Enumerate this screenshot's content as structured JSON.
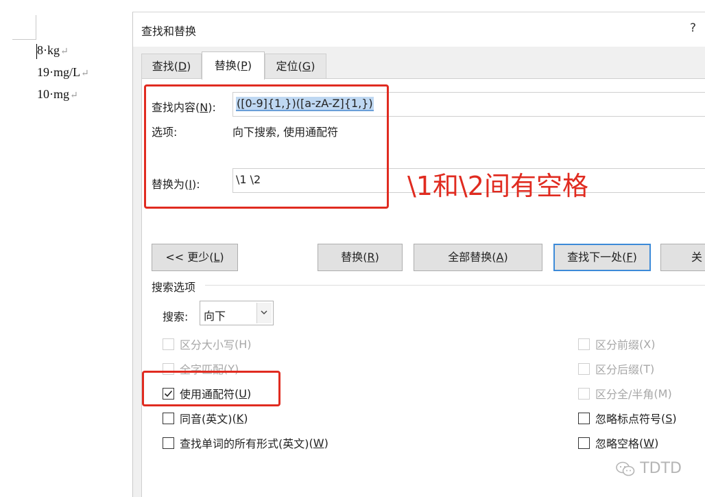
{
  "document": {
    "lines": [
      "8·kg",
      "19·mg/L",
      "10·mg"
    ],
    "paragraph_mark": "↵"
  },
  "dialog": {
    "title": "查找和替换",
    "help": "?",
    "tabs": [
      {
        "label": "查找",
        "key": "D"
      },
      {
        "label": "替换",
        "key": "P"
      },
      {
        "label": "定位",
        "key": "G"
      }
    ],
    "find": {
      "label": "查找内容",
      "key": "N",
      "value": "([0-9]{1,})([a-zA-Z]{1,})"
    },
    "options": {
      "label": "选项:",
      "value": "向下搜索, 使用通配符"
    },
    "replace": {
      "label": "替换为",
      "key": "I",
      "value": "\\1 \\2"
    },
    "buttons": {
      "less": {
        "label": "<< 更少",
        "key": "L"
      },
      "replace": {
        "label": "替换",
        "key": "R"
      },
      "replace_all": {
        "label": "全部替换",
        "key": "A"
      },
      "find_next": {
        "label": "查找下一处",
        "key": "F"
      },
      "close": {
        "label": "关"
      }
    },
    "search_options": {
      "title": "搜索选项",
      "search_label": "搜索:",
      "direction": "向下",
      "left_checks": [
        {
          "label": "区分大小写",
          "key": "H",
          "checked": false,
          "disabled": true
        },
        {
          "label": "全字匹配",
          "key": "Y",
          "checked": false,
          "disabled": true
        },
        {
          "label": "使用通配符",
          "key": "U",
          "checked": true,
          "disabled": false
        },
        {
          "label": "同音(英文)",
          "key": "K",
          "checked": false,
          "disabled": false
        },
        {
          "label": "查找单词的所有形式(英文)",
          "key": "W",
          "checked": false,
          "disabled": false
        }
      ],
      "right_checks": [
        {
          "label": "区分前缀",
          "key": "X",
          "checked": false,
          "disabled": true
        },
        {
          "label": "区分后缀",
          "key": "T",
          "checked": false,
          "disabled": true
        },
        {
          "label": "区分全/半角",
          "key": "M",
          "checked": false,
          "disabled": true
        },
        {
          "label": "忽略标点符号",
          "key": "S",
          "checked": false,
          "disabled": false
        },
        {
          "label": "忽略空格",
          "key": "W",
          "checked": false,
          "disabled": false
        }
      ]
    }
  },
  "annotation": {
    "text": "\\1和\\2间有空格",
    "color": "#e02b20"
  },
  "watermark": {
    "text": "TDTD",
    "icon": "wechat-icon"
  }
}
